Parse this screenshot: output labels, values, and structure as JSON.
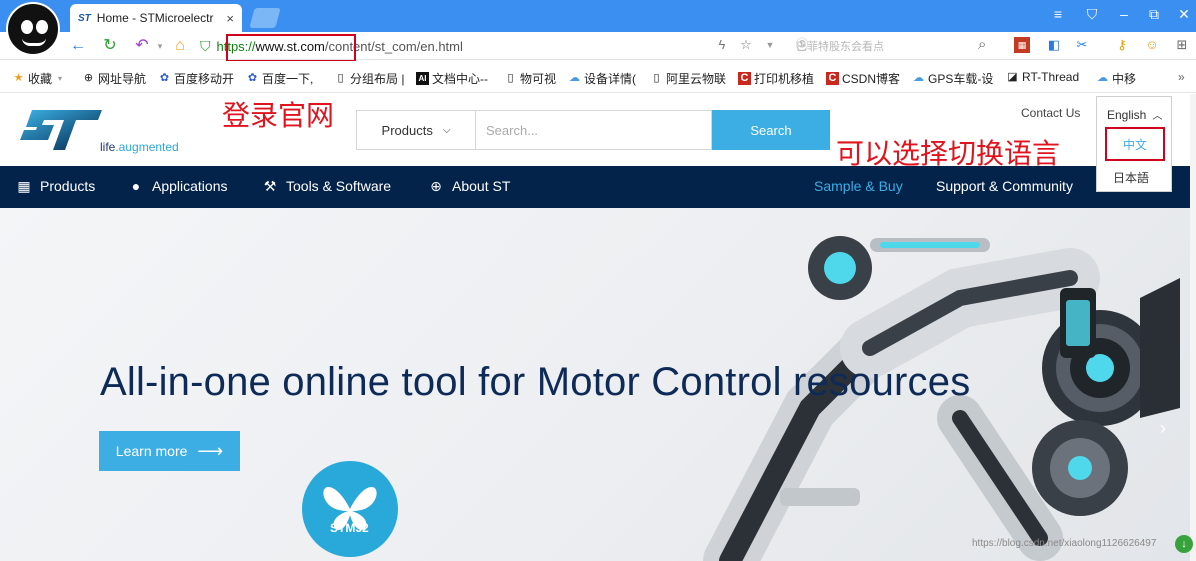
{
  "browser": {
    "tab": {
      "title": "Home - STMicroelectr",
      "close": "×"
    },
    "window_controls": [
      "≡",
      "⛉",
      "–",
      "⧉",
      "✕"
    ],
    "address": {
      "scheme": "https://",
      "host": "www.st.com",
      "path": "/content/st_com/en.html"
    },
    "search_hint": "巴菲特股东会看点"
  },
  "bookmarks": {
    "items": [
      {
        "label": "收藏",
        "icon": "star-icon"
      },
      {
        "label": "网址导航",
        "icon": "globe-icon"
      },
      {
        "label": "百度移动开",
        "icon": "paw-icon"
      },
      {
        "label": "百度一下,",
        "icon": "paw-icon"
      },
      {
        "label": "分组布局 |",
        "icon": "page-icon"
      },
      {
        "label": "文档中心--",
        "icon": "ai-icon"
      },
      {
        "label": "物可视",
        "icon": "page-icon"
      },
      {
        "label": "设备详情(",
        "icon": "cloud-icon"
      },
      {
        "label": "阿里云物联",
        "icon": "page-icon"
      },
      {
        "label": "打印机移植",
        "icon": "csdn-icon"
      },
      {
        "label": "CSDN博客",
        "icon": "csdn-icon"
      },
      {
        "label": "GPS车载-设",
        "icon": "cloud-icon"
      },
      {
        "label": "RT-Thread",
        "icon": "rt-icon"
      },
      {
        "label": "中移",
        "icon": "cloud-icon"
      }
    ],
    "more": "»"
  },
  "site": {
    "tagline_prefix": "life",
    "tagline_suffix": ".augmented",
    "annotation_login": "登录官网",
    "annotation_lang": "可以选择切换语言",
    "products_dropdown": "Products",
    "search_placeholder": "Search...",
    "search_button": "Search",
    "contact": "Contact Us",
    "languages": {
      "current": "English",
      "zh": "中文",
      "ja": "日本語"
    },
    "nav": [
      {
        "label": "Products",
        "icon": "grid-icon"
      },
      {
        "label": "Applications",
        "icon": "bulb-icon"
      },
      {
        "label": "Tools & Software",
        "icon": "wrench-icon"
      },
      {
        "label": "About ST",
        "icon": "globe-icon"
      }
    ],
    "nav_right": [
      {
        "label": "Sample & Buy"
      },
      {
        "label": "Support & Community"
      }
    ],
    "hero": {
      "title": "All-in-one online tool for Motor Control resources",
      "button": "Learn more",
      "badge": "STM32"
    },
    "watermark": "https://blog.csdn.net/xiaolong1126626497"
  }
}
